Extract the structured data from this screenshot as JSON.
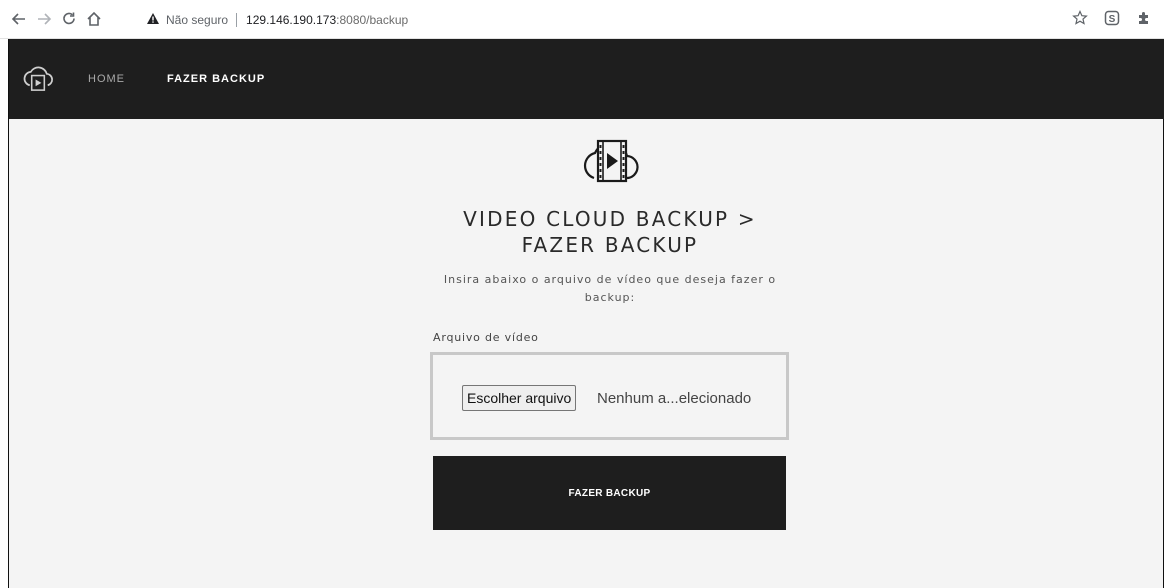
{
  "browser": {
    "not_secure": "Não seguro",
    "url_host": "129.146.190.173",
    "url_rest": ":8080/backup"
  },
  "header": {
    "nav": [
      {
        "label": "HOME"
      },
      {
        "label": "FAZER BACKUP"
      }
    ]
  },
  "main": {
    "title_line1": "VIDEO CLOUD BACKUP >",
    "title_line2": "FAZER BACKUP",
    "subtitle_line1": "Insira abaixo o arquivo de vídeo que deseja fazer o",
    "subtitle_line2": "backup:",
    "field_label": "Arquivo de vídeo",
    "file_button": "Escolher arquivo",
    "file_status": "Nenhum a...elecionado",
    "submit": "FAZER BACKUP"
  },
  "icons": {
    "logo": "cloud-video-icon",
    "hero": "cloud-video-icon"
  },
  "colors": {
    "header_bg": "#1e1e1e",
    "page_bg": "#f4f4f4",
    "button_bg": "#1e1e1e"
  }
}
